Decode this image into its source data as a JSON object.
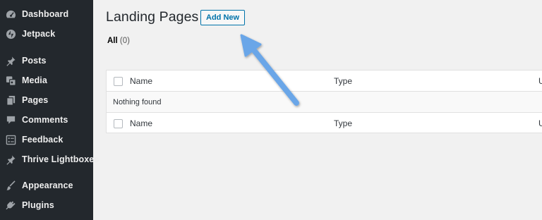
{
  "sidebar": {
    "items": [
      {
        "label": "Dashboard",
        "icon": "dashboard-icon"
      },
      {
        "label": "Jetpack",
        "icon": "jetpack-icon"
      },
      {
        "label": "Posts",
        "icon": "pin-icon"
      },
      {
        "label": "Media",
        "icon": "media-icon"
      },
      {
        "label": "Pages",
        "icon": "pages-icon"
      },
      {
        "label": "Comments",
        "icon": "comment-icon"
      },
      {
        "label": "Feedback",
        "icon": "feedback-icon"
      },
      {
        "label": "Thrive Lightboxes",
        "icon": "pin-icon"
      },
      {
        "label": "Appearance",
        "icon": "brush-icon"
      },
      {
        "label": "Plugins",
        "icon": "plugin-icon"
      }
    ]
  },
  "main": {
    "title": "Landing Pages",
    "add_new_label": "Add New",
    "filter": {
      "label": "All",
      "count": "(0)"
    },
    "table": {
      "columns": {
        "name": "Name",
        "type": "Type",
        "third": "U"
      },
      "empty_message": "Nothing found"
    }
  },
  "colors": {
    "sidebar_bg": "#23282d",
    "accent": "#0073aa",
    "annotation_arrow": "#6aa6e8"
  }
}
